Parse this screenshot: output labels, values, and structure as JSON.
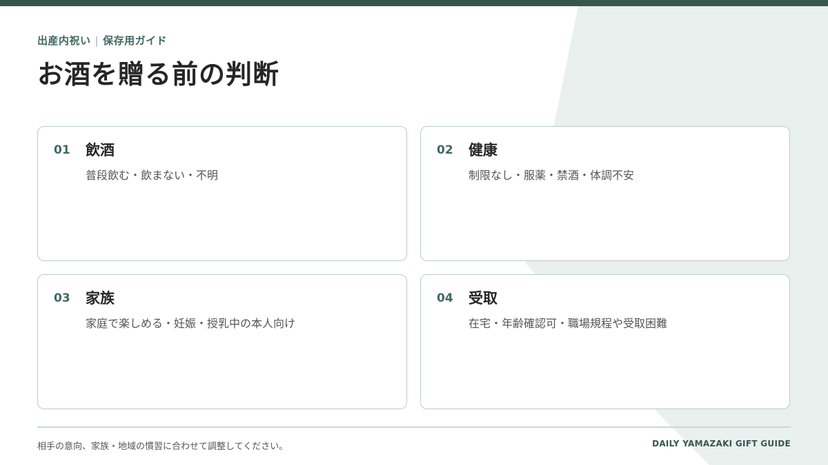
{
  "header": {
    "eyebrow_left": "出産内祝い",
    "eyebrow_sep": "|",
    "eyebrow_right": "保存用ガイド",
    "title": "お酒を贈る前の判断"
  },
  "cards": [
    {
      "num": "01",
      "title": "飲酒",
      "desc": "普段飲む・飲まない・不明"
    },
    {
      "num": "02",
      "title": "健康",
      "desc": "制限なし・服薬・禁酒・体調不安"
    },
    {
      "num": "03",
      "title": "家族",
      "desc": "家庭で楽しめる・妊娠・授乳中の本人向け"
    },
    {
      "num": "04",
      "title": "受取",
      "desc": "在宅・年齢確認可・職場規程や受取困難"
    }
  ],
  "footer": {
    "note": "相手の意向、家族・地域の慣習に合わせて調整してください。",
    "brand": "DAILY YAMAZAKI GIFT GUIDE"
  },
  "colors": {
    "accent": "#35574f",
    "accent_text": "#3f6a61",
    "background_shape": "#e9f0ed",
    "card_border": "#b8cdc7"
  }
}
